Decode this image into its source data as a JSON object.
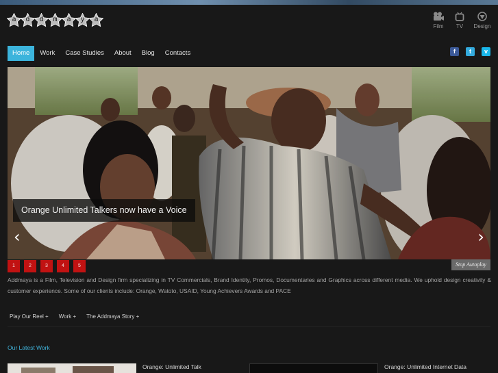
{
  "brand": {
    "letters": [
      "a",
      "d",
      "d",
      "m",
      "a",
      "y",
      "a"
    ]
  },
  "media_links": [
    {
      "label": "Film",
      "icon": "film-camera-icon"
    },
    {
      "label": "TV",
      "icon": "tv-icon"
    },
    {
      "label": "Design",
      "icon": "design-icon"
    }
  ],
  "nav": {
    "items": [
      "Home",
      "Work",
      "Case Studies",
      "About",
      "Blog",
      "Contacts"
    ],
    "active": "Home",
    "accent": "#3cb4dc"
  },
  "social": [
    {
      "name": "facebook-icon",
      "glyph": "f",
      "color": "#3b5998"
    },
    {
      "name": "twitter-icon",
      "glyph": "t",
      "color": "#33aadd"
    },
    {
      "name": "vimeo-icon",
      "glyph": "v",
      "color": "#1ab7ea"
    }
  ],
  "slider": {
    "caption": "Orange Unlimited Talkers now have a Voice",
    "prev": "‹",
    "next": "›",
    "pages": [
      "1",
      "2",
      "3",
      "4",
      "5"
    ],
    "autoplay": "Stop Autoplay",
    "pager_color": "#c11212"
  },
  "description": "Addmaya is a Film, Television and Design firm specializing in TV Commercials, Brand Identity, Promos, Documentaries and Graphics across different media. We uphold design creativity & customer experience. Some of our clients include: Orange, Watoto, USAID, Young Achievers Awards and PACE",
  "sublinks": [
    "Play Our Reel +",
    "Work +",
    "The Addmaya Story +"
  ],
  "latest": {
    "heading": "Our Latest Work",
    "items": [
      {
        "title": "Orange: Unlimited Talk"
      },
      {
        "title": "Orange: Unlimited Internet Data"
      }
    ]
  }
}
